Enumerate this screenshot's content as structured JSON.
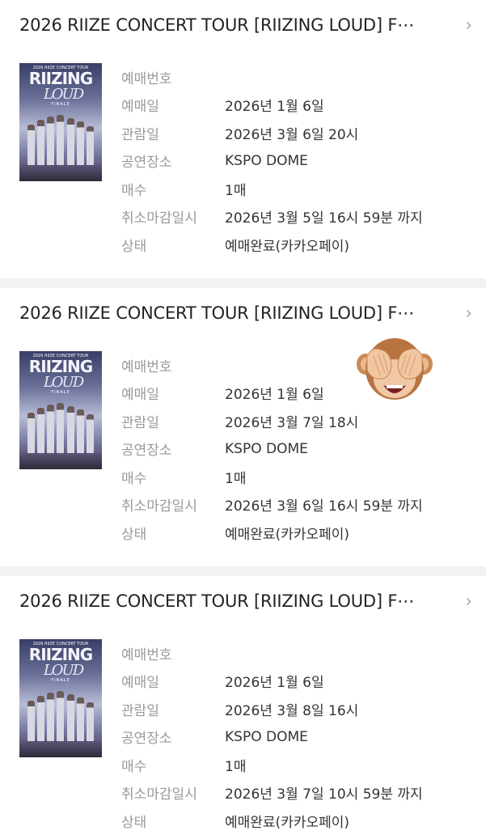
{
  "cards": [
    {
      "title": "2026 RIIZE CONCERT TOUR [RIIZING LOUD] F⋯",
      "poster": {
        "top": "2026 RIIZE CONCERT TOUR",
        "logo": "RIIZING",
        "script": "LOUD",
        "sub": "FINALE"
      },
      "labels": [
        "예매번호",
        "예매일",
        "관람일",
        "공연장소",
        "매수",
        "취소마감일시",
        "상태"
      ],
      "values": [
        "",
        "2026년 1월 6일",
        "2026년 3월 6일 20시",
        "KSPO DOME",
        "1매",
        "2026년 3월 5일 16시 59분 까지",
        "예매완료(카카오페이)"
      ]
    },
    {
      "title": "2026 RIIZE CONCERT TOUR [RIIZING LOUD] F⋯",
      "poster": {
        "top": "2026 RIIZE CONCERT TOUR",
        "logo": "RIIZING",
        "script": "LOUD",
        "sub": "FINALE"
      },
      "labels": [
        "예매번호",
        "예매일",
        "관람일",
        "공연장소",
        "매수",
        "취소마감일시",
        "상태"
      ],
      "values": [
        "",
        "2026년 1월 6일",
        "2026년 3월 7일 18시",
        "KSPO DOME",
        "1매",
        "2026년 3월 6일 16시 59분 까지",
        "예매완료(카카오페이)"
      ]
    },
    {
      "title": "2026 RIIZE CONCERT TOUR [RIIZING LOUD] F⋯",
      "poster": {
        "top": "2026 RIIZE CONCERT TOUR",
        "logo": "RIIZING",
        "script": "LOUD",
        "sub": "FINALE"
      },
      "labels": [
        "예매번호",
        "예매일",
        "관람일",
        "공연장소",
        "매수",
        "취소마감일시",
        "상태"
      ],
      "values": [
        "",
        "2026년 1월 6일",
        "2026년 3월 8일 16시",
        "KSPO DOME",
        "1매",
        "2026년 3월 7일 10시 59분 까지",
        "예매완료(카카오페이)"
      ]
    }
  ],
  "icons": {
    "chevron": "›",
    "monkey": "see-no-evil-monkey-sticker"
  }
}
